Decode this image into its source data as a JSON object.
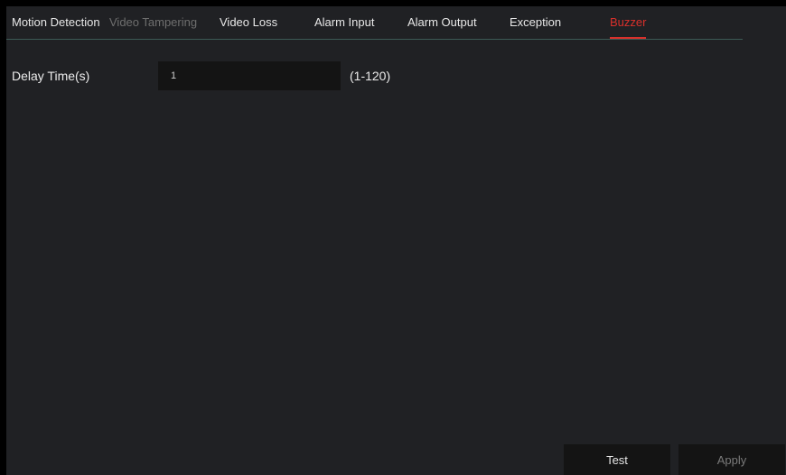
{
  "tabs": [
    {
      "label": "Motion Detection",
      "state": "normal"
    },
    {
      "label": "Video Tampering",
      "state": "disabled"
    },
    {
      "label": "Video Loss",
      "state": "normal"
    },
    {
      "label": "Alarm Input",
      "state": "normal"
    },
    {
      "label": "Alarm Output",
      "state": "normal"
    },
    {
      "label": "Exception",
      "state": "normal"
    },
    {
      "label": "Buzzer",
      "state": "active"
    }
  ],
  "form": {
    "delay_label": "Delay Time(s)",
    "delay_value": "1",
    "delay_range": "(1-120)"
  },
  "buttons": {
    "test_label": "Test",
    "apply_label": "Apply"
  },
  "colors": {
    "background": "#202124",
    "active_tab": "#d9302b",
    "tab_underline": "#3c5a55",
    "input_background": "#141414"
  }
}
